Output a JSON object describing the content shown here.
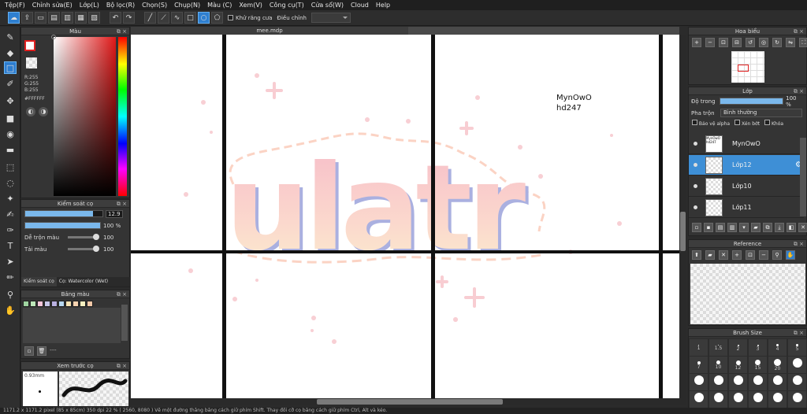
{
  "menu": [
    "Tệp(F)",
    "Chỉnh sửa(E)",
    "Lớp(L)",
    "Bộ lọc(R)",
    "Chọn(S)",
    "Chụp(N)",
    "Màu (C)",
    "Xem(V)",
    "Công cụ(T)",
    "Cửa sổ(W)",
    "Cloud",
    "Help"
  ],
  "toolbar": {
    "antialias_label": "Khử răng cưa",
    "adjust_label": "Điều chỉnh"
  },
  "document": {
    "tab_title": "mee.mdp",
    "annotation_1": "MynOwO",
    "annotation_2": "hd247",
    "lettering": "ulatr"
  },
  "color_panel": {
    "title": "Màu",
    "r": "R:255",
    "g": "G:255",
    "b": "B:255",
    "hex": "#FFFFFF",
    "primary_color": "#ffffff",
    "accent": "#e02020"
  },
  "brush_control": {
    "title": "Kiểm soát cọ",
    "size_value": "12.9",
    "opacity_value": "100 %",
    "blend_label": "Dễ trộn màu",
    "blend_value": "100",
    "thickness_label": "Tải màu",
    "thickness_value": "100",
    "tab_1": "Kiểm soát cọ",
    "tab_2": "Cọ: Watercolor (Wet)",
    "size_fraction": 0.88,
    "opacity_fraction": 1.0,
    "blend_fraction": 1.0,
    "thickness_fraction": 1.0
  },
  "palette": {
    "title": "Bảng màu",
    "colors": [
      "#9fd4a0",
      "#bde7b9",
      "#f5c6da",
      "#c7c7e8",
      "#b9b0e0",
      "#b8d8f0",
      "#f7e3b3",
      "#f7d3b0",
      "#f5f0c0",
      "#f3c9a8"
    ]
  },
  "preview": {
    "title": "Xem trước cọ",
    "size_label": "0.93mm"
  },
  "navigator": {
    "title": "Hoa biểu"
  },
  "layers": {
    "title": "Lớp",
    "opacity_label": "Độ trong",
    "opacity_value": "100 %",
    "blend_label": "Pha trộn",
    "blend_value": "Bình thường",
    "protect_alpha": "Bảo vệ alpha",
    "clipping": "Xén bớt",
    "lock": "Khóa",
    "items": [
      {
        "name": "MynOwO",
        "thumb_text": "MynOwO hd247"
      },
      {
        "name": "Lớp12"
      },
      {
        "name": "Lớp10"
      },
      {
        "name": "Lớp11"
      }
    ]
  },
  "reference": {
    "title": "Reference"
  },
  "brush_size": {
    "title": "Brush Size",
    "sizes": [
      "1",
      "1.5",
      "2",
      "3",
      "4",
      "5",
      "7",
      "10",
      "12",
      "15",
      "20",
      "",
      ""
    ]
  },
  "status": {
    "text": "1171.2 x 1171.2 pixel  (85 x 85cm)  350 dpi  22 %  ( 2560, 8080 )  Vẽ một đường thẳng bằng cách giữ phím Shift. Thay đổi cỡ cọ bằng cách giữ phím Ctrl, Alt và kéo."
  }
}
